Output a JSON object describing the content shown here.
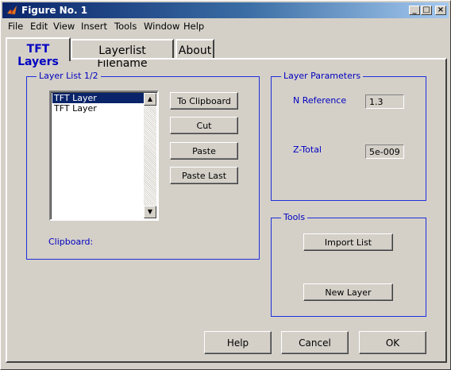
{
  "window": {
    "title": "Figure No. 1",
    "minimize": "_",
    "maximize": "□",
    "close": "×"
  },
  "menu": [
    "File",
    "Edit",
    "View",
    "Insert",
    "Tools",
    "Window",
    "Help"
  ],
  "tabs": [
    {
      "label": "TFT Layers",
      "active": true
    },
    {
      "label": "Layerlist Filename",
      "active": false
    },
    {
      "label": "About",
      "active": false
    }
  ],
  "layer_list": {
    "title": "Layer List 1/2",
    "items": [
      {
        "label": "TFT Layer",
        "selected": true
      },
      {
        "label": "TFT Layer",
        "selected": false
      }
    ],
    "clipboard_label": "Clipboard:",
    "buttons": {
      "to_clipboard": "To Clipboard",
      "cut": "Cut",
      "paste": "Paste",
      "paste_last": "Paste Last"
    }
  },
  "layer_parameters": {
    "title": "Layer Parameters",
    "n_reference_label": "N Reference",
    "n_reference_value": "1.3",
    "z_total_label": "Z-Total",
    "z_total_value": "5e-009"
  },
  "tools": {
    "title": "Tools",
    "import_list": "Import List",
    "new_layer": "New Layer"
  },
  "footer": {
    "help": "Help",
    "cancel": "Cancel",
    "ok": "OK"
  },
  "colors": {
    "title_bar": "#0a246a",
    "label_blue": "#0000c0",
    "group_border": "#1f2fdb",
    "face": "#d4d0c8"
  }
}
